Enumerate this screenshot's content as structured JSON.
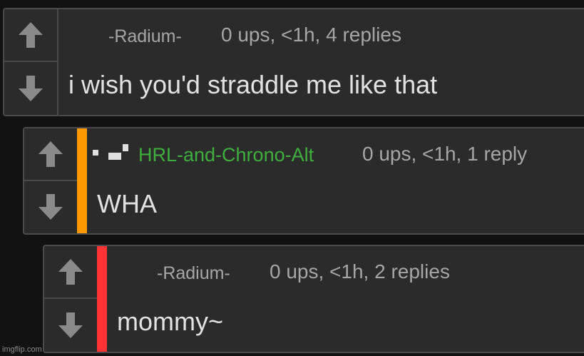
{
  "comments": [
    {
      "user": "-Radium-",
      "meta": "0 ups, <1h, 4 replies",
      "text": "i wish you'd straddle me like that",
      "upvote_icon": "arrow-up-icon",
      "downvote_icon": "arrow-down-icon"
    },
    {
      "user": "HRL-and-Chrono-Alt",
      "user_color": "#3fae3f",
      "badge_icon": "pixel-badge-icon",
      "meta": "0 ups, <1h, 1 reply",
      "text": "WHA",
      "stripe_color": "#ff9900",
      "upvote_icon": "arrow-up-icon",
      "downvote_icon": "arrow-down-icon"
    },
    {
      "user": "-Radium-",
      "meta": "0 ups, <1h, 2 replies",
      "text": "mommy~",
      "stripe_color": "#ff3333",
      "upvote_icon": "arrow-up-icon",
      "downvote_icon": "arrow-down-icon"
    }
  ],
  "watermark": "imgflip.com"
}
